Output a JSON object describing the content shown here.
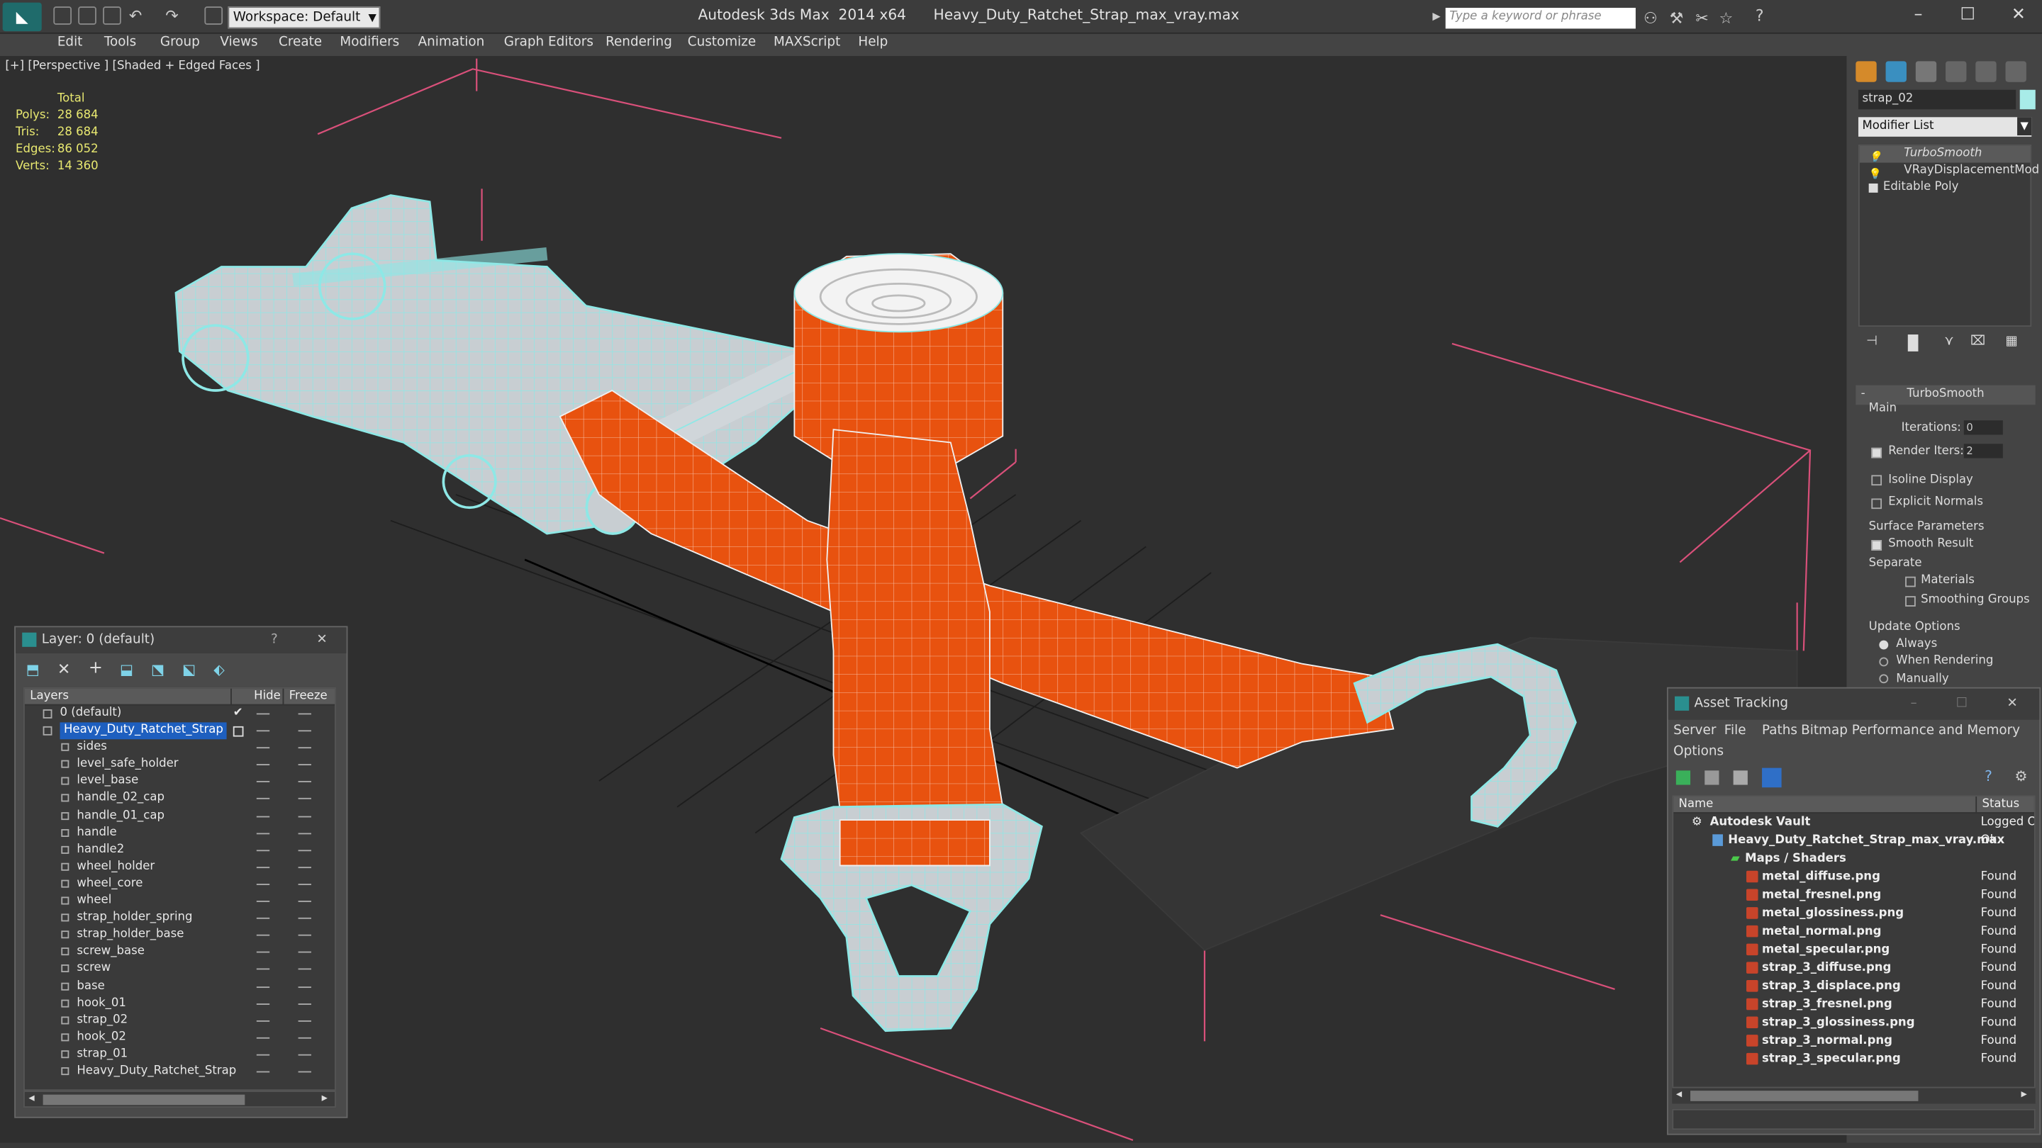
{
  "titlebar": {
    "workspace": "Workspace: Default",
    "title": "Autodesk 3ds Max  2014 x64      Heavy_Duty_Ratchet_Strap_max_vray.max",
    "search_placeholder": "Type a keyword or phrase"
  },
  "menubar": [
    "Edit",
    "Tools",
    "Group",
    "Views",
    "Create",
    "Modifiers",
    "Animation",
    "Graph Editors",
    "Rendering",
    "Customize",
    "MAXScript",
    "Help"
  ],
  "viewport": {
    "label": "[+] [Perspective ] [Shaded + Edged Faces ]",
    "stats_header": "Total",
    "stats": [
      {
        "k": "Polys:",
        "v": "28 684"
      },
      {
        "k": "Tris:",
        "v": "28 684"
      },
      {
        "k": "Edges:",
        "v": "86 052"
      },
      {
        "k": "Verts:",
        "v": "14 360"
      }
    ],
    "strap_color": "#e8520f",
    "wire_color": "#8ee8e6",
    "metal_color": "#c8ced2"
  },
  "layer_panel": {
    "title": "Layer: 0 (default)",
    "help": "?",
    "col_layers": "Layers",
    "col_hide": "Hide",
    "col_freeze": "Freeze",
    "default_layer": "0 (default)",
    "selected_layer": "Heavy_Duty_Ratchet_Strap",
    "items": [
      "sides",
      "level_safe_holder",
      "level_base",
      "handle_02_cap",
      "handle_01_cap",
      "handle",
      "handle2",
      "wheel_holder",
      "wheel_core",
      "wheel",
      "strap_holder_spring",
      "strap_holder_base",
      "screw_base",
      "screw",
      "base",
      "hook_01",
      "strap_02",
      "hook_02",
      "strap_01",
      "Heavy_Duty_Ratchet_Strap"
    ]
  },
  "command_panel": {
    "object_name": "strap_02",
    "modifier_list": "Modifier List",
    "stack": [
      "TurboSmooth",
      "VRayDisplacementMod",
      "Editable Poly"
    ],
    "rollout_title": "TurboSmooth",
    "main_label": "Main",
    "iterations_label": "Iterations:",
    "iterations_value": "0",
    "render_iters_label": "Render Iters:",
    "render_iters_value": "2",
    "isoline": "Isoline Display",
    "explicit_normals": "Explicit Normals",
    "surface_params": "Surface Parameters",
    "smooth_result": "Smooth Result",
    "separate": "Separate",
    "materials": "Materials",
    "smoothing_groups": "Smoothing Groups",
    "update_options": "Update Options",
    "always": "Always",
    "when_rendering": "When Rendering",
    "manually": "Manually"
  },
  "asset_tracking": {
    "title": "Asset Tracking",
    "menu": [
      "Server",
      "File",
      "Paths",
      "Bitmap Performance and Memory"
    ],
    "menu2": "Options",
    "col_name": "Name",
    "col_status": "Status",
    "vault": {
      "name": "Autodesk Vault",
      "status": "Logged O"
    },
    "file": {
      "name": "Heavy_Duty_Ratchet_Strap_max_vray.max",
      "status": "Ok"
    },
    "maps_folder": "Maps / Shaders",
    "maps": [
      {
        "name": "metal_diffuse.png",
        "status": "Found"
      },
      {
        "name": "metal_fresnel.png",
        "status": "Found"
      },
      {
        "name": "metal_glossiness.png",
        "status": "Found"
      },
      {
        "name": "metal_normal.png",
        "status": "Found"
      },
      {
        "name": "metal_specular.png",
        "status": "Found"
      },
      {
        "name": "strap_3_diffuse.png",
        "status": "Found"
      },
      {
        "name": "strap_3_displace.png",
        "status": "Found"
      },
      {
        "name": "strap_3_fresnel.png",
        "status": "Found"
      },
      {
        "name": "strap_3_glossiness.png",
        "status": "Found"
      },
      {
        "name": "strap_3_normal.png",
        "status": "Found"
      },
      {
        "name": "strap_3_specular.png",
        "status": "Found"
      }
    ]
  }
}
